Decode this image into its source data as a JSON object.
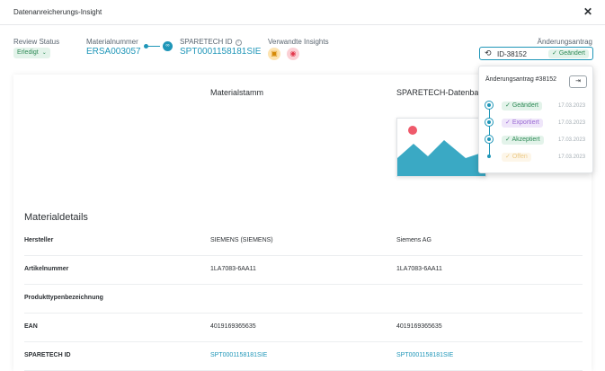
{
  "window": {
    "title": "Datenanreicherungs-Insight",
    "close_glyph": "✕"
  },
  "header": {
    "review_status_label": "Review Status",
    "review_status_value": "Erledigt",
    "material_number_label": "Materialnummer",
    "material_number_value": "ERSA003057",
    "sparetech_id_label": "SPARETECH ID",
    "sparetech_id_value": "SPT0001158181SIE",
    "related_insights_label": "Verwandte Insights",
    "change_request_label": "Änderungsantrag",
    "change_request_id": "ID-38152",
    "change_request_status": "Geändert"
  },
  "columns": {
    "material_master": "Materialstamm",
    "sparetech_db": "SPARETECH-Datenbank"
  },
  "details": {
    "section_title": "Materialdetails",
    "rows": [
      {
        "label": "Hersteller",
        "material": "SIEMENS (SIEMENS)",
        "sparetech": "Siemens AG"
      },
      {
        "label": "Artikelnummer",
        "material": "1LA7083-6AA11",
        "sparetech": "1LA7083-6AA11"
      },
      {
        "label": "Produkttypenbezeichnung",
        "material": "",
        "sparetech": ""
      },
      {
        "label": "EAN",
        "material": "4019169365635",
        "sparetech": "4019169365635"
      },
      {
        "label": "SPARETECH ID",
        "material": "SPT0001158181SIE",
        "sparetech": "SPT0001158181SIE"
      }
    ]
  },
  "popup": {
    "title": "Änderungsantrag #38152",
    "events": [
      {
        "status": "Geändert",
        "date": "17.03.2023",
        "color": "#2e8a56",
        "bg": "#e3f3ea"
      },
      {
        "status": "Exportiert",
        "date": "17.03.2023",
        "color": "#9b6bd4",
        "bg": "#efe6fa"
      },
      {
        "status": "Akzeptiert",
        "date": "17.03.2023",
        "color": "#2e8a56",
        "bg": "#e3f3ea"
      },
      {
        "status": "Offen",
        "date": "17.03.2023",
        "color": "#e0a93a",
        "bg": "#fcf1dc"
      }
    ]
  },
  "icons": {
    "close": "close-icon",
    "link": "link-icon",
    "info": "info-icon",
    "history": "history-icon",
    "export": "export-icon",
    "check": "check-icon",
    "chevron": "chevron-down-icon",
    "image": "image-placeholder-icon"
  },
  "colors": {
    "accent": "#1f96b8",
    "success": "#2e8a56",
    "success_bg": "#e3f3ea",
    "warning": "#d58a08",
    "danger": "#e2384d"
  }
}
